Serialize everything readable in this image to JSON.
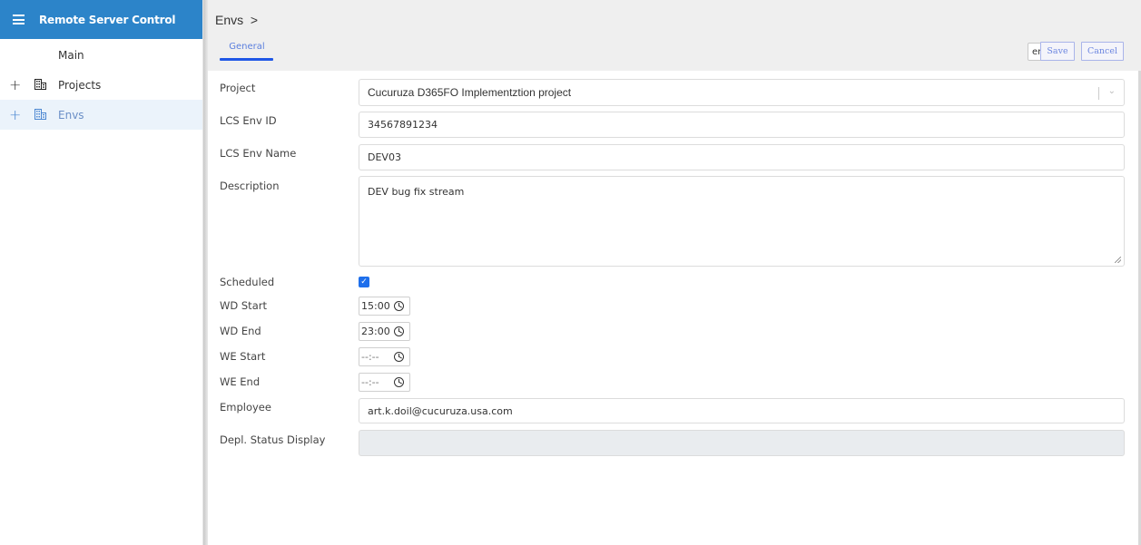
{
  "sidebar": {
    "title": "Remote Server Control",
    "items": [
      {
        "label": "Main"
      },
      {
        "label": "Projects",
        "expand": "+",
        "icon": "building-icon"
      },
      {
        "label": "Envs",
        "expand": "+",
        "icon": "building-icon",
        "active": true
      }
    ]
  },
  "header": {
    "breadcrumb": "Envs  >",
    "tabs": [
      {
        "label": "General",
        "active": true
      }
    ],
    "language": "en",
    "save_label": "Save",
    "cancel_label": "Cancel"
  },
  "form": {
    "project": {
      "label": "Project",
      "value": "Cucuruza D365FO Implementztion project"
    },
    "lcs_env_id": {
      "label": "LCS Env ID",
      "value": "34567891234"
    },
    "lcs_env_name": {
      "label": "LCS Env Name",
      "value": "DEV03"
    },
    "description": {
      "label": "Description",
      "value": "DEV bug fix stream"
    },
    "scheduled": {
      "label": "Scheduled",
      "checked": true
    },
    "wd_start": {
      "label": "WD Start",
      "value": "15:00"
    },
    "wd_end": {
      "label": "WD End",
      "value": "23:00"
    },
    "we_start": {
      "label": "WE Start",
      "value": "--:--"
    },
    "we_end": {
      "label": "WE End",
      "value": "--:--"
    },
    "employee": {
      "label": "Employee",
      "value": "art.k.doil@cucuruza.usa.com"
    },
    "depl_status": {
      "label": "Depl. Status Display",
      "value": ""
    }
  },
  "colors": {
    "brand": "#2c84c9",
    "accent": "#1f57e6",
    "active_nav_bg": "#ebf3fb"
  }
}
